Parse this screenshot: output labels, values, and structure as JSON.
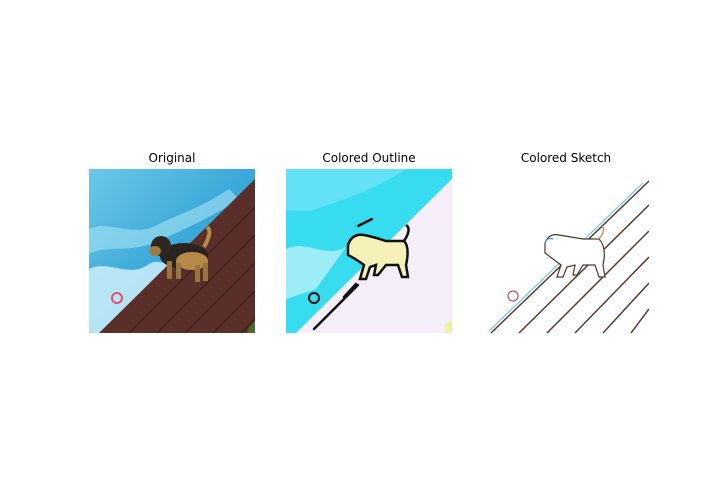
{
  "panels": [
    {
      "title": "Original"
    },
    {
      "title": "Colored Outline"
    },
    {
      "title": "Colored Sketch"
    }
  ],
  "colors": {
    "water": "#3fb4e0",
    "water_light": "#7fd3ee",
    "deck": "#5a2f2a",
    "outline_cyan": "#38dcf0",
    "outline_bg": "#f6eefa",
    "sketch_line": "#5b3a2e",
    "dog_fill": "#f4f0b8"
  }
}
